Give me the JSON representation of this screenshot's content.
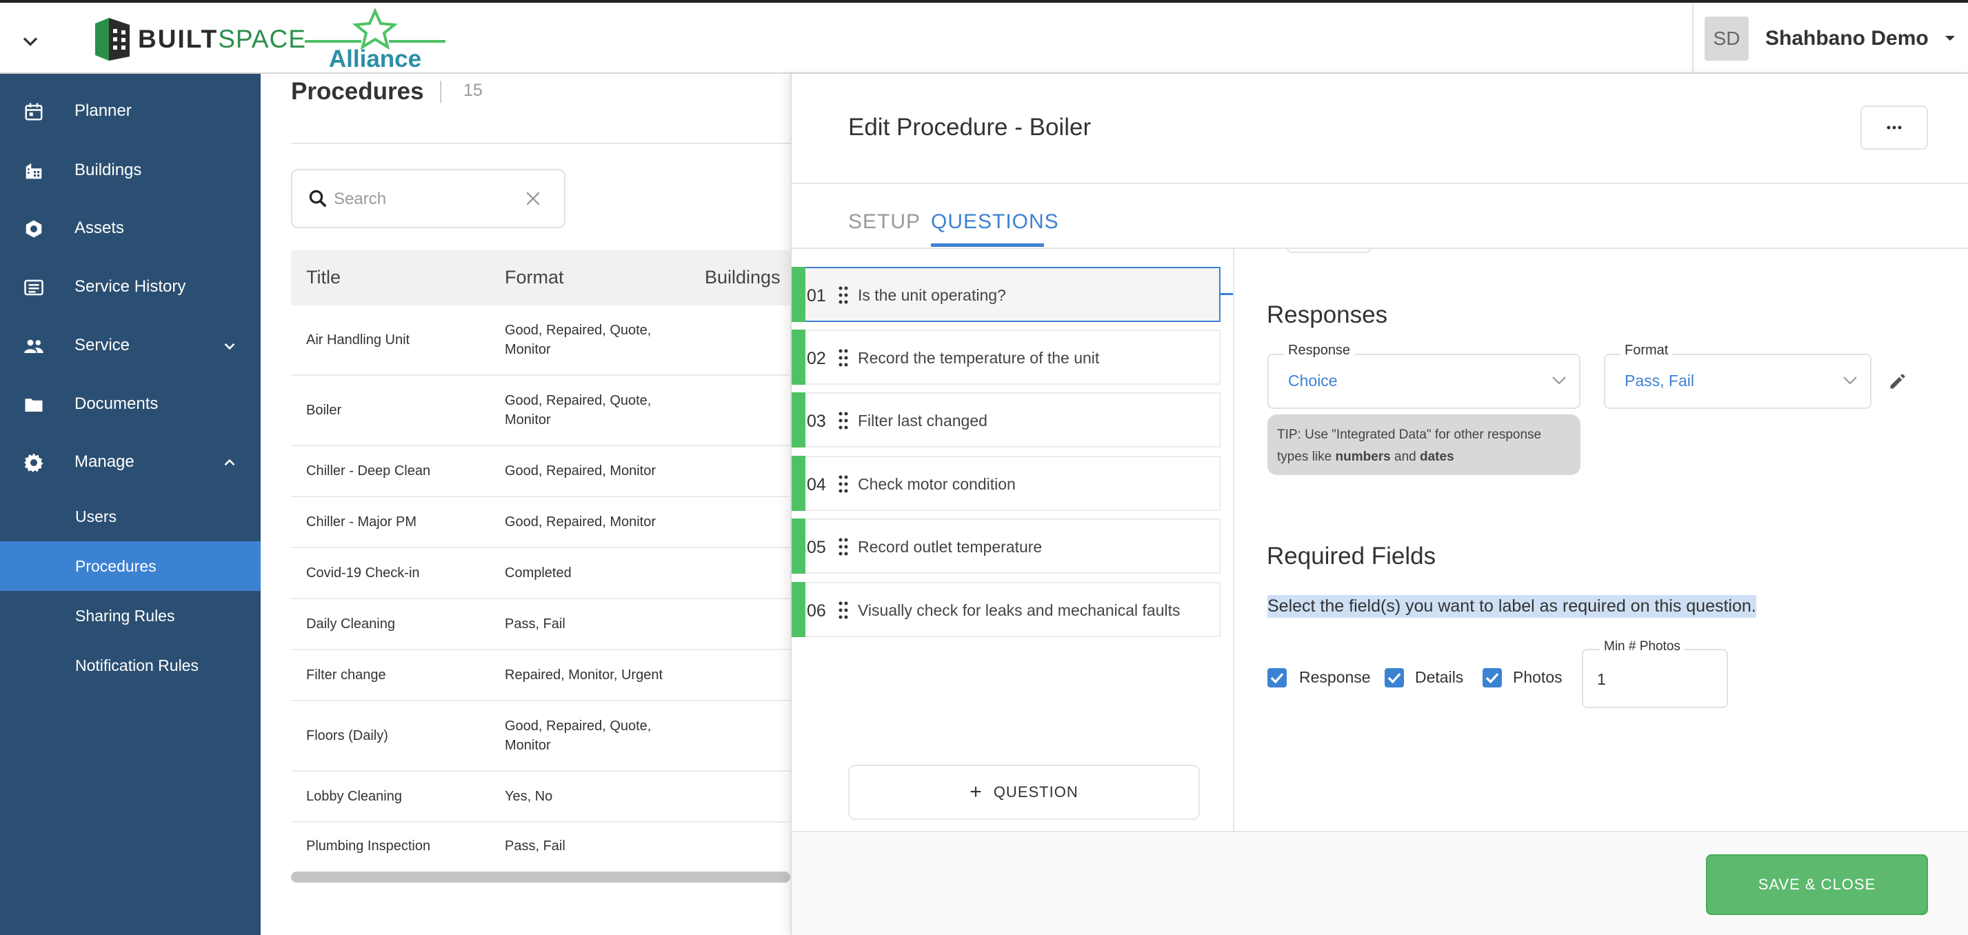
{
  "header": {
    "logo_builtspace_a": "BUILT",
    "logo_builtspace_b": "SPACE",
    "logo_alliance": "Alliance",
    "user_initials": "SD",
    "user_name": "Shahbano Demo"
  },
  "sidebar": {
    "items": [
      {
        "label": "Planner",
        "icon": "calendar-icon"
      },
      {
        "label": "Buildings",
        "icon": "building-icon"
      },
      {
        "label": "Assets",
        "icon": "hexagon-icon"
      },
      {
        "label": "Service History",
        "icon": "list-icon"
      },
      {
        "label": "Service",
        "icon": "people-icon",
        "expanded": false
      },
      {
        "label": "Documents",
        "icon": "folder-icon"
      },
      {
        "label": "Manage",
        "icon": "gear-icon",
        "expanded": true
      }
    ],
    "sub_items": [
      {
        "label": "Users"
      },
      {
        "label": "Procedures",
        "active": true
      },
      {
        "label": "Sharing Rules"
      },
      {
        "label": "Notification Rules"
      }
    ]
  },
  "procedures_list": {
    "title": "Procedures",
    "count": "15",
    "search_placeholder": "Search",
    "columns": [
      "Title",
      "Format",
      "Buildings"
    ],
    "rows": [
      {
        "title": "Air Handling Unit",
        "format_line1": "Good, Repaired, Quote,",
        "format_line2": "Monitor"
      },
      {
        "title": "Boiler",
        "format_line1": "Good, Repaired, Quote,",
        "format_line2": "Monitor"
      },
      {
        "title": "Chiller - Deep Clean",
        "format_line1": "Good, Repaired, Monitor",
        "format_line2": ""
      },
      {
        "title": "Chiller - Major PM",
        "format_line1": "Good, Repaired, Monitor",
        "format_line2": ""
      },
      {
        "title": "Covid-19 Check-in",
        "format_line1": "Completed",
        "format_line2": ""
      },
      {
        "title": "Daily Cleaning",
        "format_line1": "Pass, Fail",
        "format_line2": ""
      },
      {
        "title": "Filter change",
        "format_line1": "Repaired, Monitor, Urgent",
        "format_line2": ""
      },
      {
        "title": "Floors (Daily)",
        "format_line1": "Good, Repaired, Quote,",
        "format_line2": "Monitor"
      },
      {
        "title": "Lobby Cleaning",
        "format_line1": "Yes, No",
        "format_line2": ""
      },
      {
        "title": "Plumbing Inspection",
        "format_line1": "Pass, Fail",
        "format_line2": ""
      }
    ]
  },
  "edit_panel": {
    "title": "Edit Procedure - Boiler",
    "tabs": [
      "SETUP",
      "QUESTIONS"
    ],
    "active_tab": "QUESTIONS",
    "questions": [
      {
        "num": "01",
        "text": "Is the unit operating?",
        "selected": true
      },
      {
        "num": "02",
        "text": "Record the temperature of the unit"
      },
      {
        "num": "03",
        "text": "Filter last changed"
      },
      {
        "num": "04",
        "text": "Check motor condition"
      },
      {
        "num": "05",
        "text": "Record outlet temperature"
      },
      {
        "num": "06",
        "text": "Visually check for leaks and mechanical faults"
      }
    ],
    "add_question_label": "QUESTION",
    "responses": {
      "section_title": "Responses",
      "response_label": "Response",
      "response_value": "Choice",
      "format_label": "Format",
      "format_value": "Pass, Fail",
      "tip_line1": "TIP: Use \"Integrated Data\" for other response",
      "tip_line2_a": "types like ",
      "tip_bold1": "numbers",
      "tip_and": " and ",
      "tip_bold2": "dates"
    },
    "required_fields": {
      "section_title": "Required Fields",
      "description": "Select the field(s) you want to label as required on this question.",
      "checkboxes": [
        {
          "label": "Response",
          "checked": true
        },
        {
          "label": "Details",
          "checked": true
        },
        {
          "label": "Photos",
          "checked": true
        }
      ],
      "min_photos_label": "Min # Photos",
      "min_photos_value": "1"
    },
    "save_label": "SAVE & CLOSE"
  },
  "colors": {
    "sidebar_bg": "#2b4f72",
    "sidebar_active": "#3c82d3",
    "accent_blue": "#3c82d3",
    "question_bar_green": "#4ec265",
    "save_green": "#5cb96d"
  }
}
